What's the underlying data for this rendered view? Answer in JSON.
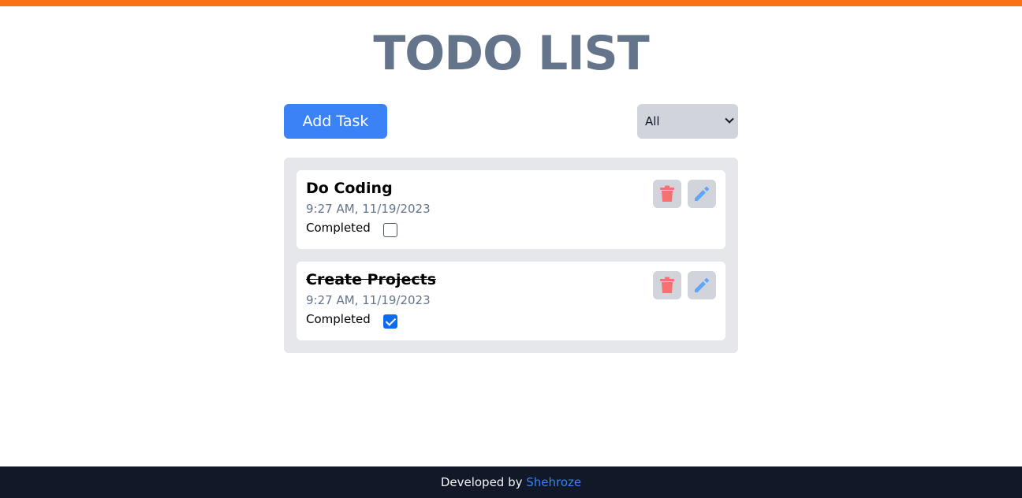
{
  "title": "TODO LIST",
  "toolbar": {
    "add_label": "Add Task",
    "filter_selected": "All"
  },
  "tasks": [
    {
      "title": "Do Coding",
      "time": "9:27 AM, 11/19/2023",
      "status_label": "Completed",
      "completed": false
    },
    {
      "title": "Create Projects",
      "time": "9:27 AM, 11/19/2023",
      "status_label": "Completed",
      "completed": true
    }
  ],
  "icons": {
    "delete": "trash-icon",
    "edit": "pencil-icon"
  },
  "colors": {
    "accent_bar": "#f97316",
    "primary": "#3b82f6",
    "delete_icon": "#f87171",
    "edit_icon": "#60a5fa",
    "footer_bg": "#111827"
  },
  "footer": {
    "prefix": "Developed by ",
    "author": "Shehroze"
  }
}
